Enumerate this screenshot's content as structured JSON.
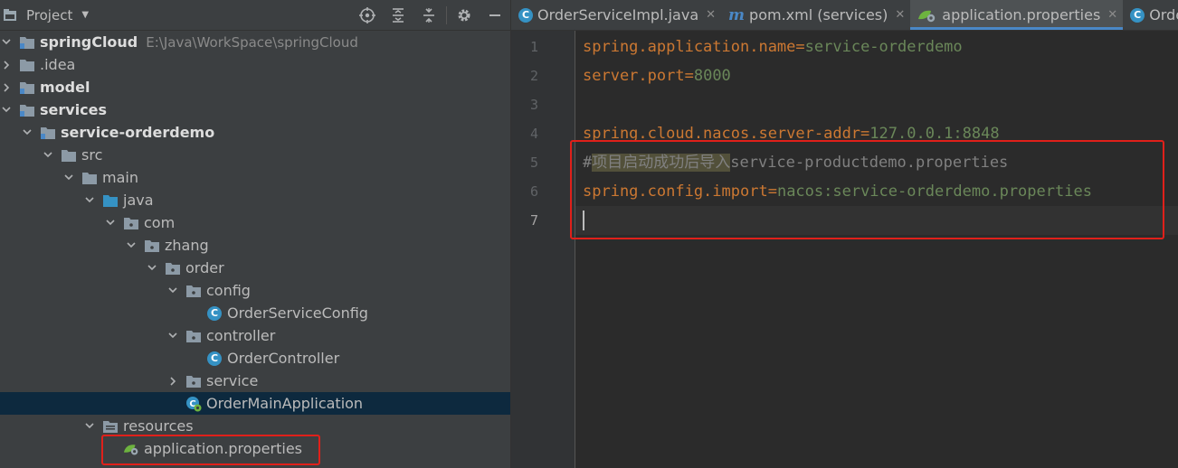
{
  "project_panel": {
    "title": "Project"
  },
  "tree": [
    {
      "label": "springCloud",
      "path": "E:\\Java\\WorkSpace\\springCloud",
      "kind": "module",
      "bold": true,
      "depth": 0,
      "arrow": "down"
    },
    {
      "label": ".idea",
      "kind": "folder",
      "depth": 0,
      "arrow": "right"
    },
    {
      "label": "model",
      "kind": "module",
      "bold": true,
      "depth": 0,
      "arrow": "right"
    },
    {
      "label": "services",
      "kind": "module",
      "bold": true,
      "depth": 0,
      "arrow": "down"
    },
    {
      "label": "service-orderdemo",
      "kind": "module",
      "bold": true,
      "depth": 1,
      "arrow": "down"
    },
    {
      "label": "src",
      "kind": "folder",
      "depth": 2,
      "arrow": "down"
    },
    {
      "label": "main",
      "kind": "folder",
      "depth": 3,
      "arrow": "down"
    },
    {
      "label": "java",
      "kind": "source-folder",
      "depth": 4,
      "arrow": "down"
    },
    {
      "label": "com",
      "kind": "package",
      "depth": 5,
      "arrow": "down"
    },
    {
      "label": "zhang",
      "kind": "package",
      "depth": 6,
      "arrow": "down"
    },
    {
      "label": "order",
      "kind": "package",
      "depth": 7,
      "arrow": "down"
    },
    {
      "label": "config",
      "kind": "package",
      "depth": 8,
      "arrow": "down"
    },
    {
      "label": "OrderServiceConfig",
      "kind": "class",
      "depth": 9,
      "arrow": "none"
    },
    {
      "label": "controller",
      "kind": "package",
      "depth": 8,
      "arrow": "down"
    },
    {
      "label": "OrderController",
      "kind": "class",
      "depth": 9,
      "arrow": "none"
    },
    {
      "label": "service",
      "kind": "package",
      "depth": 8,
      "arrow": "right"
    },
    {
      "label": "OrderMainApplication",
      "kind": "spring-boot-class",
      "depth": 8,
      "arrow": "none",
      "selected": true
    },
    {
      "label": "resources",
      "kind": "resources-folder",
      "depth": 4,
      "arrow": "down"
    },
    {
      "label": "application.properties",
      "kind": "properties-file",
      "depth": 5,
      "arrow": "none"
    }
  ],
  "tabs": [
    {
      "label": "OrderServiceImpl.java",
      "icon": "class-icon",
      "active": false
    },
    {
      "label": "pom.xml (services)",
      "icon": "maven-icon",
      "active": false
    },
    {
      "label": "application.properties",
      "icon": "spring-properties-icon",
      "active": true
    },
    {
      "label": "OrderCo",
      "icon": "class-icon",
      "active": false
    }
  ],
  "editor": {
    "lines": [
      {
        "n": "1",
        "key": "spring.application.name",
        "eq": "=",
        "value": "service-orderdemo"
      },
      {
        "n": "2",
        "key": "server.port",
        "eq": "=",
        "value": "8000"
      },
      {
        "n": "3"
      },
      {
        "n": "4",
        "key": "spring.cloud.nacos.server-addr",
        "eq": "=",
        "value": "127.0.0.1:8848"
      },
      {
        "n": "5",
        "comment_hash": "#",
        "comment_cn": "项目启动成功后导入",
        "comment_rest": "service-productdemo.properties"
      },
      {
        "n": "6",
        "key": "spring.config.import",
        "eq": "=",
        "value": "nacos:service-orderdemo.properties"
      },
      {
        "n": "7",
        "current": true
      }
    ]
  },
  "colors": {
    "key": "#cc7832",
    "value": "#6a8759",
    "comment": "#808080",
    "annotation_box": "#e0201a",
    "tab_underline": "#4a88c7",
    "selection": "#0d293e"
  }
}
